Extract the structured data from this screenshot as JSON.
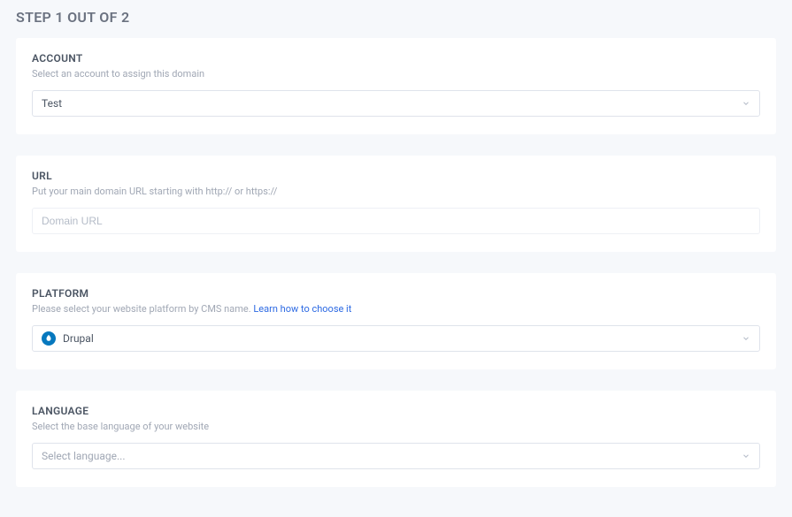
{
  "page_title": "STEP 1 OUT OF 2",
  "account": {
    "label": "ACCOUNT",
    "description": "Select an account to assign this domain",
    "value": "Test"
  },
  "url": {
    "label": "URL",
    "description": "Put your main domain URL starting with http:// or https://",
    "placeholder": "Domain URL"
  },
  "platform": {
    "label": "PLATFORM",
    "description_prefix": "Please select your website platform by CMS name. ",
    "link_text": "Learn how to choose it",
    "value": "Drupal"
  },
  "language": {
    "label": "LANGUAGE",
    "description": "Select the base language of your website",
    "placeholder": "Select language..."
  }
}
